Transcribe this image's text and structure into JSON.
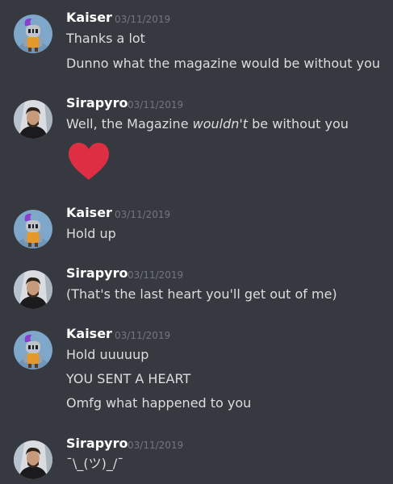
{
  "messages": [
    {
      "author": "Kaiser",
      "timestamp": "03/11/2019",
      "avatar_icon": "knight-avatar",
      "lines": [
        "Thanks a lot",
        "Dunno what the magazine would be without you"
      ]
    },
    {
      "author": "Sirapyro",
      "timestamp": "03/11/2019",
      "avatar_icon": "photo-avatar",
      "lines": {
        "pre": "Well, the Magazine ",
        "emphasis": "wouldn't",
        "post": " be without you"
      },
      "emoji": "heart-emoji"
    },
    {
      "author": "Kaiser",
      "timestamp": "03/11/2019",
      "avatar_icon": "knight-avatar",
      "lines": [
        "Hold up"
      ]
    },
    {
      "author": "Sirapyro",
      "timestamp": "03/11/2019",
      "avatar_icon": "photo-avatar",
      "lines": [
        "(That's the last heart you'll get out of me)"
      ]
    },
    {
      "author": "Kaiser",
      "timestamp": "03/11/2019",
      "avatar_icon": "knight-avatar",
      "lines": [
        "Hold uuuuup",
        "YOU SENT A HEART",
        "Omfg what happened to you"
      ]
    },
    {
      "author": "Sirapyro",
      "timestamp": "03/11/2019",
      "avatar_icon": "photo-avatar",
      "lines": [
        "¯\\_(ツ)_/¯"
      ]
    }
  ],
  "colors": {
    "background": "#36393f",
    "username": "#ffffff",
    "timestamp": "#72767d",
    "text": "#dcddde",
    "heart": "#dd2e44"
  }
}
